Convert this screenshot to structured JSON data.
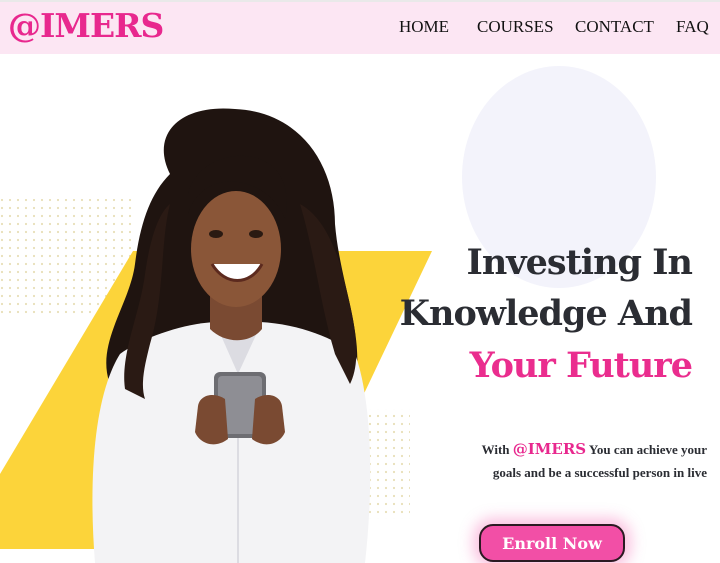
{
  "brand": {
    "logo": "@IMERS",
    "color": "#e8288e"
  },
  "nav": {
    "items": [
      {
        "label": "HOME"
      },
      {
        "label": "COURSES"
      },
      {
        "label": "CONTACT"
      },
      {
        "label": "FAQ"
      }
    ],
    "background": "#fce6f3"
  },
  "hero": {
    "headline": {
      "line1": "Investing In",
      "line2": "Knowledge And",
      "line3": "Your Future"
    },
    "tagline": {
      "prefix": "With",
      "brand": "@IMERS",
      "line1_rest": "You can achieve your",
      "line2": "goals and be a successful person in live"
    },
    "cta_label": "Enroll Now",
    "accent_color": "#ea2d8e",
    "shape_color": "#fcd43a"
  }
}
